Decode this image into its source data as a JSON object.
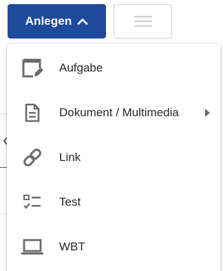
{
  "toolbar": {
    "primary_button_label": "Anlegen",
    "primary_button_icon": "chevron-up-icon",
    "secondary_button_icon": "hamburger-menu-icon"
  },
  "menu": {
    "items": [
      {
        "label": "Aufgabe",
        "icon": "edit-window-icon",
        "has_submenu": false
      },
      {
        "label": "Dokument / Multimedia",
        "icon": "document-icon",
        "has_submenu": true
      },
      {
        "label": "Link",
        "icon": "link-icon",
        "has_submenu": false
      },
      {
        "label": "Test",
        "icon": "checklist-icon",
        "has_submenu": false
      },
      {
        "label": "WBT",
        "icon": "laptop-icon",
        "has_submenu": false
      }
    ]
  },
  "colors": {
    "primary": "#1f4a9b",
    "icon": "#6b6b6b",
    "text": "#262626",
    "border": "#cfcfcf"
  }
}
